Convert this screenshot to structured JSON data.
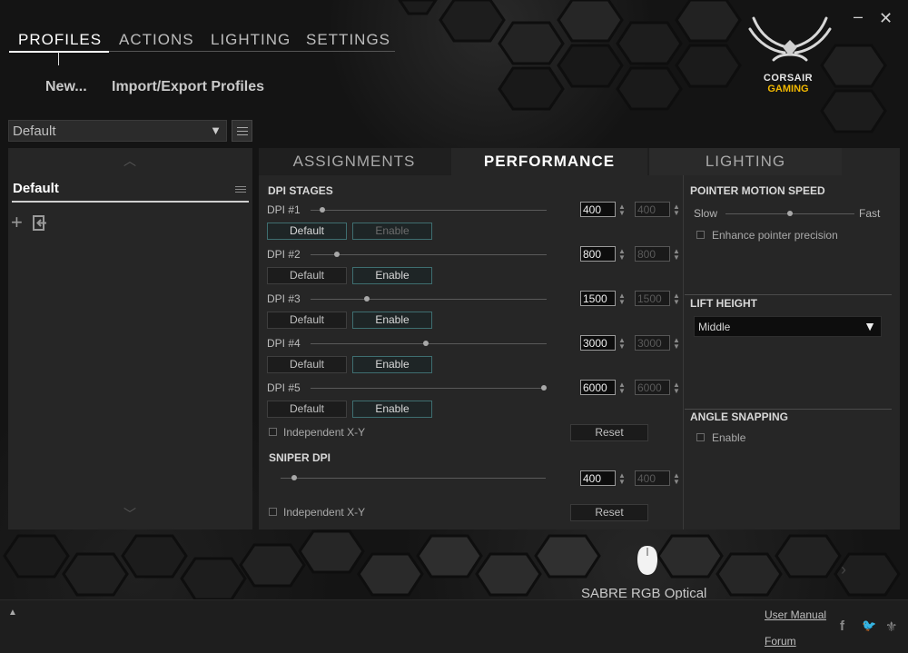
{
  "window": {
    "minimize": "–",
    "close": "✕"
  },
  "nav": {
    "tabs": [
      {
        "label": "PROFILES"
      },
      {
        "label": "ACTIONS"
      },
      {
        "label": "LIGHTING"
      },
      {
        "label": "SETTINGS"
      }
    ],
    "new_label": "New...",
    "import_export_label": "Import/Export Profiles"
  },
  "logo": {
    "line1": "CORSAIR",
    "line2": "GAMING",
    "accent_color": "#f2b800"
  },
  "profile_select": {
    "value": "Default",
    "arrow": "▼"
  },
  "profiles": {
    "items": [
      {
        "label": "Default"
      }
    ],
    "add_icon": "+",
    "up_chevron": "︿",
    "down_chevron": "﹀"
  },
  "subtabs": {
    "assignments": "ASSIGNMENTS",
    "performance": "PERFORMANCE",
    "lighting": "LIGHTING"
  },
  "dpi": {
    "title": "DPI STAGES",
    "default_label": "Default",
    "enable_label": "Enable",
    "stages": [
      {
        "label": "DPI #1",
        "value": "400",
        "y_value": "400",
        "level": 0.05
      },
      {
        "label": "DPI #2",
        "value": "800",
        "y_value": "800",
        "level": 0.11
      },
      {
        "label": "DPI #3",
        "value": "1500",
        "y_value": "1500",
        "level": 0.24
      },
      {
        "label": "DPI #4",
        "value": "3000",
        "y_value": "3000",
        "level": 0.49
      },
      {
        "label": "DPI #5",
        "value": "6000",
        "y_value": "6000",
        "level": 0.99
      }
    ],
    "independent_xy": "Independent X-Y",
    "reset": "Reset"
  },
  "sniper": {
    "title": "SNIPER DPI",
    "value": "400",
    "y_value": "400",
    "level": 0.05,
    "independent_xy": "Independent X-Y",
    "reset": "Reset"
  },
  "pointer": {
    "title": "POINTER MOTION SPEED",
    "slow": "Slow",
    "fast": "Fast",
    "level": 0.5,
    "enhance": "Enhance pointer precision"
  },
  "lift": {
    "title": "LIFT HEIGHT",
    "value": "Middle",
    "arrow": "▼"
  },
  "angle": {
    "title": "ANGLE SNAPPING",
    "enable": "Enable"
  },
  "device": {
    "name": "SABRE RGB Optical",
    "next_arrow": "›"
  },
  "footer": {
    "up_arrow": "▲",
    "user_manual": "User Manual",
    "forum": "Forum",
    "facebook": "f",
    "twitter": "🐦",
    "corsair": "⚜"
  }
}
